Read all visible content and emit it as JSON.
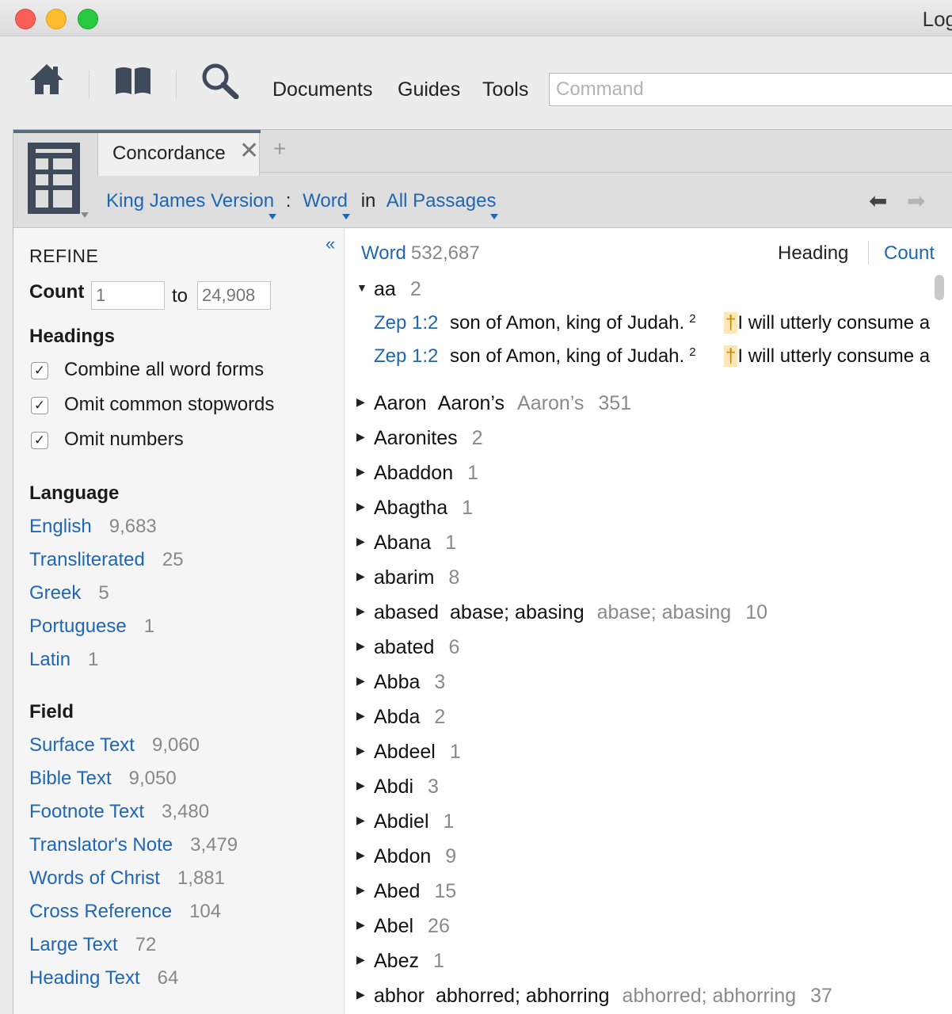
{
  "window": {
    "title": "Log"
  },
  "toolbar": {
    "menus": [
      "Documents",
      "Guides",
      "Tools"
    ],
    "command_placeholder": "Command"
  },
  "panel": {
    "tab_label": "Concordance",
    "tab_close": "✕",
    "tab_add": "+",
    "crumb": {
      "resource": "King James Version",
      "sep": ":",
      "type": "Word",
      "in": "in",
      "range": "All Passages"
    },
    "nav_back": "⬅",
    "nav_forward": "➡"
  },
  "sidebar": {
    "collapse": "«",
    "refine": "REFINE",
    "count_label": "Count",
    "count_min": "1",
    "count_to": "to",
    "count_max": "24,908",
    "headings_title": "Headings",
    "checkboxes": [
      {
        "label": "Combine all word forms",
        "mark": "✓"
      },
      {
        "label": "Omit common stopwords",
        "mark": "✓"
      },
      {
        "label": "Omit numbers",
        "mark": "✓"
      }
    ],
    "language_title": "Language",
    "languages": [
      {
        "label": "English",
        "count": "9,683"
      },
      {
        "label": "Transliterated",
        "count": "25"
      },
      {
        "label": "Greek",
        "count": "5"
      },
      {
        "label": "Portuguese",
        "count": "1"
      },
      {
        "label": "Latin",
        "count": "1"
      }
    ],
    "field_title": "Field",
    "fields": [
      {
        "label": "Surface Text",
        "count": "9,060"
      },
      {
        "label": "Bible Text",
        "count": "9,050"
      },
      {
        "label": "Footnote Text",
        "count": "3,480"
      },
      {
        "label": "Translator's Note",
        "count": "3,479"
      },
      {
        "label": "Words of Christ",
        "count": "1,881"
      },
      {
        "label": "Cross Reference",
        "count": "104"
      },
      {
        "label": "Large Text",
        "count": "72"
      },
      {
        "label": "Heading Text",
        "count": "64"
      }
    ]
  },
  "main": {
    "col_word": "Word",
    "col_word_count": "532,687",
    "col_heading": "Heading",
    "col_count": "Count",
    "expanded": {
      "word": "aa",
      "count": "2",
      "toggle": "▼",
      "hits": [
        {
          "ref": "Zep 1:2",
          "context": "son of Amon, king of Judah.",
          "sup": "2",
          "mark": "†",
          "after": "I will utterly consume a"
        },
        {
          "ref": "Zep 1:2",
          "context": "son of Amon, king of Judah.",
          "sup": "2",
          "mark": "†",
          "after": "I will utterly consume a"
        }
      ]
    },
    "entries": [
      {
        "word": "Aaron",
        "variant": "Aaron’s",
        "gray": "Aaron’s",
        "count": "351"
      },
      {
        "word": "Aaronites",
        "variant": "",
        "gray": "",
        "count": "2"
      },
      {
        "word": "Abaddon",
        "variant": "",
        "gray": "",
        "count": "1"
      },
      {
        "word": "Abagtha",
        "variant": "",
        "gray": "",
        "count": "1"
      },
      {
        "word": "Abana",
        "variant": "",
        "gray": "",
        "count": "1"
      },
      {
        "word": "abarim",
        "variant": "",
        "gray": "",
        "count": "8"
      },
      {
        "word": "abased",
        "variant": "abase; abasing",
        "gray": "abase; abasing",
        "count": "10"
      },
      {
        "word": "abated",
        "variant": "",
        "gray": "",
        "count": "6"
      },
      {
        "word": "Abba",
        "variant": "",
        "gray": "",
        "count": "3"
      },
      {
        "word": "Abda",
        "variant": "",
        "gray": "",
        "count": "2"
      },
      {
        "word": "Abdeel",
        "variant": "",
        "gray": "",
        "count": "1"
      },
      {
        "word": "Abdi",
        "variant": "",
        "gray": "",
        "count": "3"
      },
      {
        "word": "Abdiel",
        "variant": "",
        "gray": "",
        "count": "1"
      },
      {
        "word": "Abdon",
        "variant": "",
        "gray": "",
        "count": "9"
      },
      {
        "word": "Abed",
        "variant": "",
        "gray": "",
        "count": "15"
      },
      {
        "word": "Abel",
        "variant": "",
        "gray": "",
        "count": "26"
      },
      {
        "word": "Abez",
        "variant": "",
        "gray": "",
        "count": "1"
      },
      {
        "word": "abhor",
        "variant": "abhorred; abhorring",
        "gray": "abhorred; abhorring",
        "count": "37"
      }
    ],
    "collapsed_toggle": "▶"
  },
  "colors": {
    "link": "#1f66b3",
    "highlight": "#fde6b8",
    "panel_header": "#dedede"
  }
}
